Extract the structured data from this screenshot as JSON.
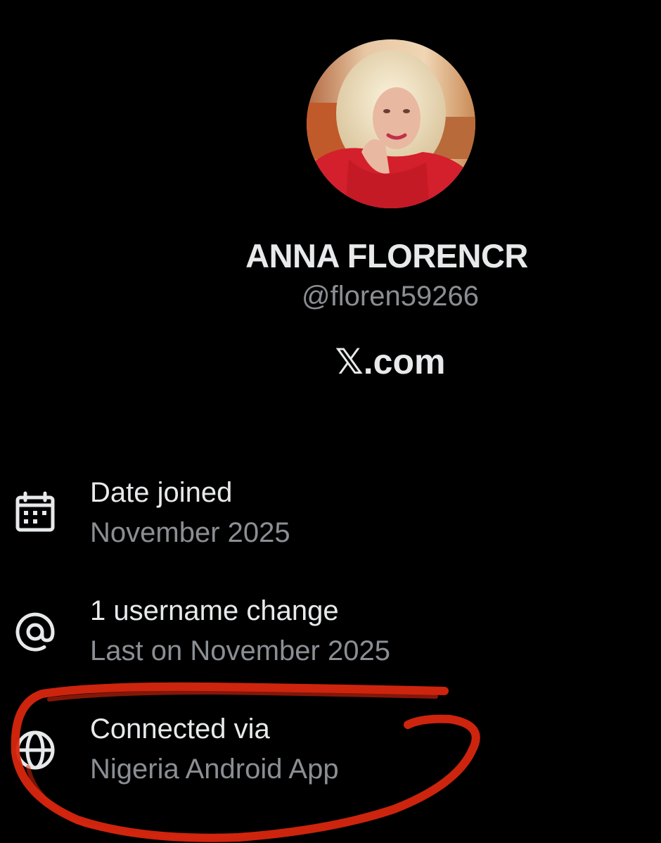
{
  "profile": {
    "display_name": "ANNA FLORENCR",
    "handle": "@floren59266",
    "platform": "𝕏.com"
  },
  "about": {
    "date_joined": {
      "icon": "calendar-icon",
      "label": "Date joined",
      "value": "November 2025"
    },
    "username_changes": {
      "icon": "at-sign-icon",
      "label": "1 username change",
      "value": "Last on November 2025"
    },
    "connected_via": {
      "icon": "globe-icon",
      "label": "Connected via",
      "value": "Nigeria Android App"
    }
  },
  "colors": {
    "background": "#000000",
    "primary_text": "#e7e9ea",
    "secondary_text": "#8b8f94",
    "annotation": "#d8260f"
  }
}
